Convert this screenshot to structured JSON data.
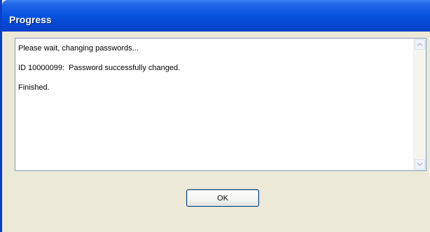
{
  "window": {
    "title": "Progress"
  },
  "log": {
    "lines": [
      "Please wait, changing passwords...",
      "ID 10000099:  Password successfully changed.",
      "Finished."
    ]
  },
  "buttons": {
    "ok_label": "OK"
  },
  "icons": {
    "scroll_up": "chevron-up-icon",
    "scroll_down": "chevron-down-icon"
  },
  "colors": {
    "titlebar": "#0548d4",
    "title_text": "#ffffff",
    "dialog_background": "#ece9d8",
    "textbox_border": "#7f9db9",
    "button_border": "#003c74"
  }
}
